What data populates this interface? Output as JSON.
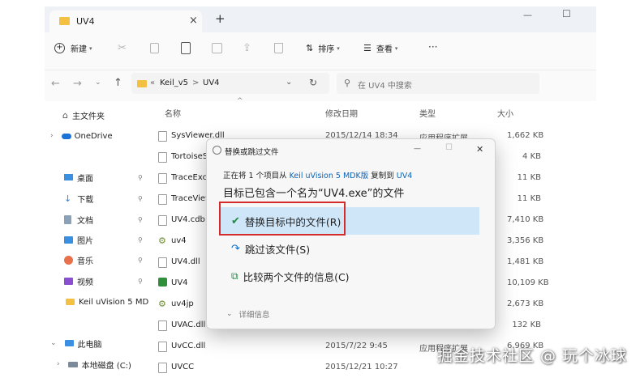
{
  "window": {
    "tab_title": "UV4",
    "new_tab_symbol": "+",
    "close_tab_symbol": "×",
    "controls": {
      "minimize": "—",
      "maximize": "☐"
    }
  },
  "toolbar": {
    "new_label": "新建",
    "sort_label": "排序",
    "view_label": "查看",
    "more_label": "···"
  },
  "address": {
    "chevron": "«",
    "crumbs": [
      "Keil_v5",
      "UV4"
    ],
    "separator": ">",
    "search_placeholder": "在 UV4 中搜索"
  },
  "sidebar": {
    "home": "主文件夹",
    "onedrive": "OneDrive",
    "pinned": [
      "桌面",
      "下载",
      "文档",
      "图片",
      "音乐",
      "视频"
    ],
    "folder": "Keil uVision 5 MD",
    "this_pc": "此电脑",
    "local_disk": "本地磁盘 (C:)"
  },
  "columns": {
    "name": "名称",
    "date": "修改日期",
    "type": "类型",
    "size": "大小"
  },
  "files": [
    {
      "name": "SysViewer.dll",
      "date": "2015/12/14 18:34",
      "type": "应用程序扩展",
      "size": "1,662 KB"
    },
    {
      "name": "TortoiseS",
      "date": "",
      "type": "",
      "size": "4 KB"
    },
    {
      "name": "TraceExcV",
      "date": "",
      "type": "",
      "size": "11 KB"
    },
    {
      "name": "TraceView",
      "date": "",
      "type": "",
      "size": "11 KB"
    },
    {
      "name": "UV4.cdb",
      "date": "",
      "type": "",
      "size": "7,410 KB"
    },
    {
      "name": "uv4",
      "date": "",
      "type": "",
      "size": "3,356 KB"
    },
    {
      "name": "UV4.dll",
      "date": "",
      "type": "",
      "size": "1,481 KB"
    },
    {
      "name": "UV4",
      "date": "",
      "type": "",
      "size": "10,109 KB"
    },
    {
      "name": "uv4jp",
      "date": "",
      "type": "",
      "size": "2,673 KB"
    },
    {
      "name": "UVAC.dll",
      "date": "",
      "type": "",
      "size": "132 KB"
    },
    {
      "name": "UvCC.dll",
      "date": "2015/7/22 9:45",
      "type": "应用程序扩展",
      "size": "6,969 KB"
    },
    {
      "name": "UVCC",
      "date": "2015/12/21 10:27",
      "type": "",
      "size": ""
    }
  ],
  "dialog": {
    "title": "替换或跳过文件",
    "copy_prefix": "正在将 1 个项目从 ",
    "copy_source": "Keil uVision 5 MDK版",
    "copy_middle": " 复制到 ",
    "copy_dest": "UV4",
    "heading": "目标已包含一个名为“UV4.exe”的文件",
    "option_replace": "替换目标中的文件(R)",
    "option_skip": "跳过该文件(S)",
    "option_compare": "比较两个文件的信息(C)",
    "details": "详细信息",
    "close_symbol": "✕",
    "min_symbol": "—",
    "max_symbol": "☐"
  },
  "watermark": "掘金技术社区 @ 玩个冰球",
  "colors": {
    "accent": "#0a6cc2",
    "link": "#0a63b8",
    "highlight_bg": "#cfe6f8",
    "outline_red": "#d62b2b",
    "check_green": "#1c8a3c"
  }
}
